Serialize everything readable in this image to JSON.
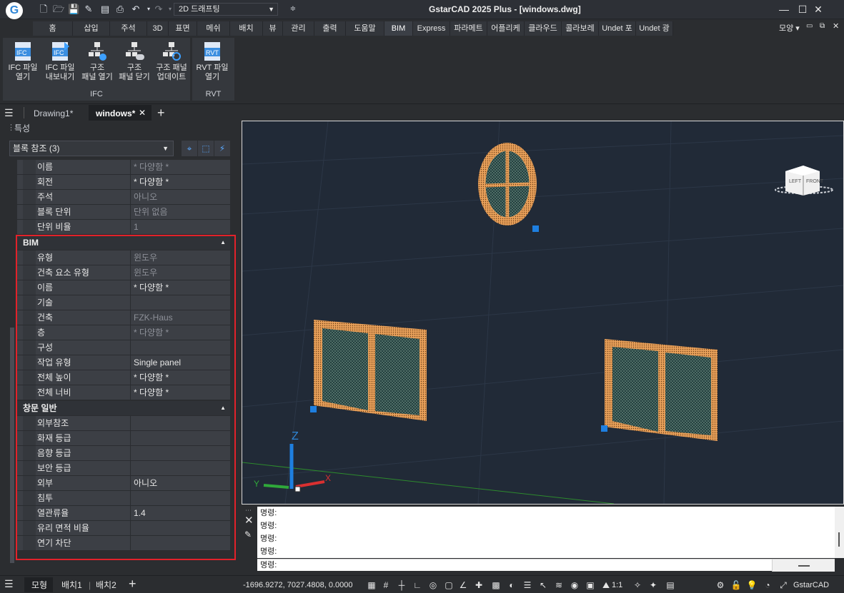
{
  "app": {
    "logo_letter": "G",
    "title": "GstarCAD 2025 Plus - [windows.dwg]",
    "workspace": "2D 드래프팅"
  },
  "ribbon_tabs": [
    "홈",
    "삽입",
    "주석",
    "3D",
    "표면",
    "메쉬",
    "배치",
    "뷰",
    "관리",
    "출력",
    "도움말",
    "BIM",
    "Express",
    "파라메트",
    "어플리케",
    "클라우드",
    "콜라보레",
    "Undet 포",
    "Undet 광"
  ],
  "active_tab": "BIM",
  "right_menu": "모양",
  "ribbon": {
    "ifc_panel": {
      "title": "IFC",
      "buttons": [
        {
          "line1": "IFC 파일",
          "line2": "열기",
          "icon": "ifc-open-icon"
        },
        {
          "line1": "IFC 파일",
          "line2": "내보내기",
          "icon": "ifc-export-icon"
        },
        {
          "line1": "구조",
          "line2": "패널 열기",
          "icon": "structure-panel-open-icon"
        },
        {
          "line1": "구조",
          "line2": "패널 닫기",
          "icon": "structure-panel-close-icon"
        },
        {
          "line1": "구조 패널",
          "line2": "업데이트",
          "icon": "structure-panel-update-icon"
        }
      ]
    },
    "rvt_panel": {
      "title": "RVT",
      "buttons": [
        {
          "line1": "RVT 파일",
          "line2": "열기",
          "icon": "rvt-open-icon"
        }
      ]
    }
  },
  "doc_tabs": [
    "Drawing1*",
    "windows*"
  ],
  "active_doc": "windows*",
  "properties": {
    "title": "특성",
    "selection": "블록 참조 (3)",
    "rows_top": [
      {
        "k": "이름",
        "v": "* 다양함 *",
        "dim": true
      },
      {
        "k": "회전",
        "v": "* 다양함 *",
        "dim": false
      },
      {
        "k": "주석",
        "v": "아니오",
        "dim": true
      },
      {
        "k": "블록 단위",
        "v": "단위 없음",
        "dim": true
      },
      {
        "k": "단위 비율",
        "v": "1",
        "dim": true
      }
    ],
    "section_bim": "BIM",
    "rows_bim": [
      {
        "k": "유형",
        "v": "윈도우",
        "dim": true
      },
      {
        "k": "건축 요소 유형",
        "v": "윈도우",
        "dim": true
      },
      {
        "k": "이름",
        "v": "* 다양함 *",
        "dim": false
      },
      {
        "k": "기술",
        "v": "",
        "dim": false
      },
      {
        "k": "건축",
        "v": "FZK-Haus",
        "dim": true
      },
      {
        "k": "층",
        "v": "* 다양함 *",
        "dim": true
      },
      {
        "k": "구성",
        "v": "",
        "dim": false
      },
      {
        "k": "작업 유형",
        "v": "Single panel",
        "dim": false
      },
      {
        "k": "전체 높이",
        "v": "* 다양함 *",
        "dim": false
      },
      {
        "k": "전체 너비",
        "v": "* 다양함 *",
        "dim": false
      }
    ],
    "section_window": "창문 일반",
    "rows_window": [
      {
        "k": "외부참조",
        "v": "",
        "dim": false
      },
      {
        "k": "화재 등급",
        "v": "",
        "dim": false
      },
      {
        "k": "음향 등급",
        "v": "",
        "dim": false
      },
      {
        "k": "보안 등급",
        "v": "",
        "dim": false
      },
      {
        "k": "외부",
        "v": "아니오",
        "dim": false
      },
      {
        "k": "침투",
        "v": "",
        "dim": false
      },
      {
        "k": "열관류율",
        "v": "1.4",
        "dim": false
      },
      {
        "k": "유리 면적 비율",
        "v": "",
        "dim": false
      },
      {
        "k": "연기 차단",
        "v": "",
        "dim": false
      }
    ]
  },
  "viewport": {
    "viewcube_left": "LEFT",
    "viewcube_front": "FRONT",
    "axis_z": "Z",
    "axis_y": "Y",
    "axis_x": "X"
  },
  "command": {
    "lines": [
      "명령:",
      "명령:",
      "명령:",
      "명령:",
      "명령:"
    ],
    "prompt": "명령:"
  },
  "status": {
    "tabs": [
      "모형",
      "배치1",
      "배치2"
    ],
    "coords": "-1696.9272, 7027.4808, 0.0000",
    "scale": "1:1",
    "brand": "GstarCAD"
  }
}
